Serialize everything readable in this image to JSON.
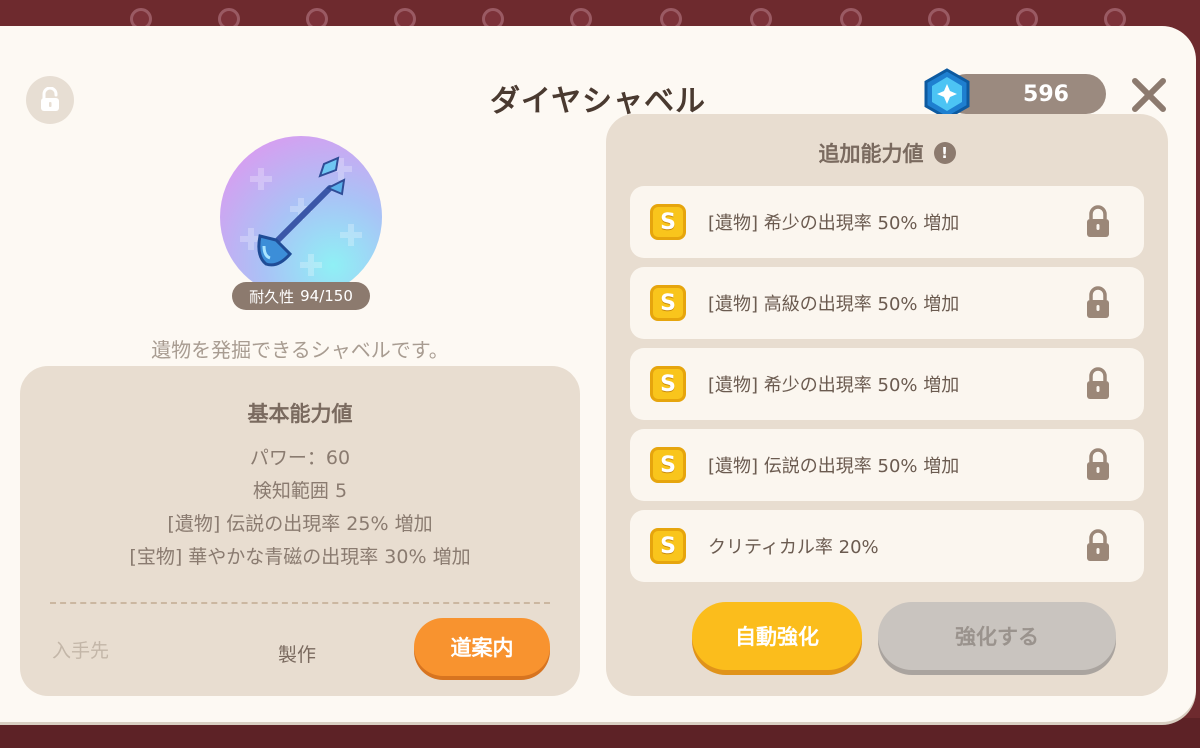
{
  "header": {
    "title": "ダイヤシャベル",
    "gem_count": "596"
  },
  "item": {
    "durability_label": "耐久性",
    "durability_value": "94/150",
    "description": "遺物を発掘できるシャベルです。"
  },
  "basic_stats": {
    "title": "基本能力値",
    "lines": [
      "パワー：60",
      "検知範囲 5",
      "[遺物] 伝説の出現率 25% 増加",
      "[宝物] 華やかな青磁の出現率 30% 増加"
    ],
    "source_label": "入手先",
    "source_value": "製作",
    "guide_button": "道案内"
  },
  "extra_stats": {
    "title": "追加能力値",
    "info_icon": "!",
    "rows": [
      {
        "grade": "S",
        "text": "[遺物] 希少の出現率 50% 増加"
      },
      {
        "grade": "S",
        "text": "[遺物] 高級の出現率 50% 増加"
      },
      {
        "grade": "S",
        "text": "[遺物] 希少の出現率 50% 増加"
      },
      {
        "grade": "S",
        "text": "[遺物] 伝説の出現率 50% 増加"
      },
      {
        "grade": "S",
        "text": "クリティカル率 20%"
      }
    ],
    "auto_button": "自動強化",
    "enhance_button": "強化する"
  },
  "colors": {
    "accent_orange": "#f8932f",
    "accent_yellow": "#fbbd1c",
    "grade_badge": "#f9c51c",
    "disabled_button": "#c9c4bf"
  },
  "icons": {
    "lock": "padlock-icon",
    "gem": "diamond-gem-icon",
    "close": "close-icon",
    "item": "diamond-shovel-icon"
  }
}
